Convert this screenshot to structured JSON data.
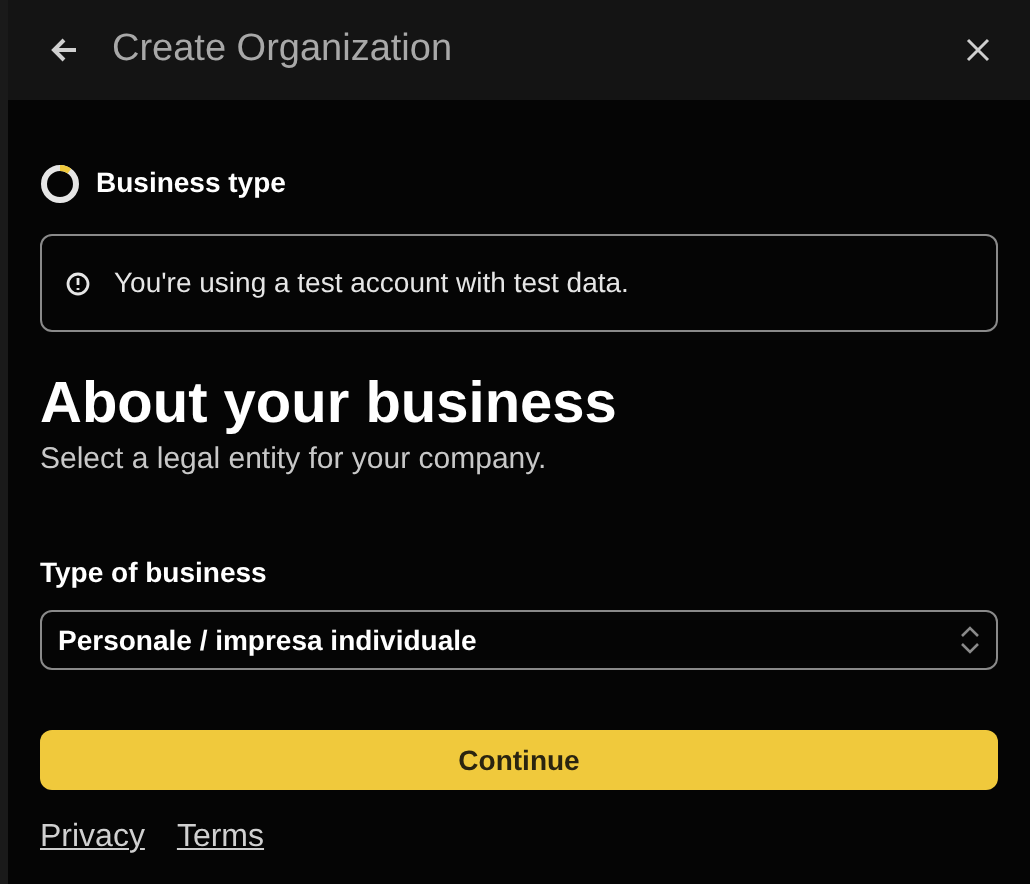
{
  "header": {
    "title": "Create Organization"
  },
  "step": {
    "label": "Business type",
    "level": 0.1
  },
  "alert": {
    "text": "You're using a test account with test data."
  },
  "heading": "About your business",
  "subtitle": "Select a legal entity for your company.",
  "field": {
    "label": "Type of business",
    "value": "Personale / impresa individuale"
  },
  "primary_button": "Continue",
  "footer_links": [
    "Privacy",
    "Terms"
  ]
}
